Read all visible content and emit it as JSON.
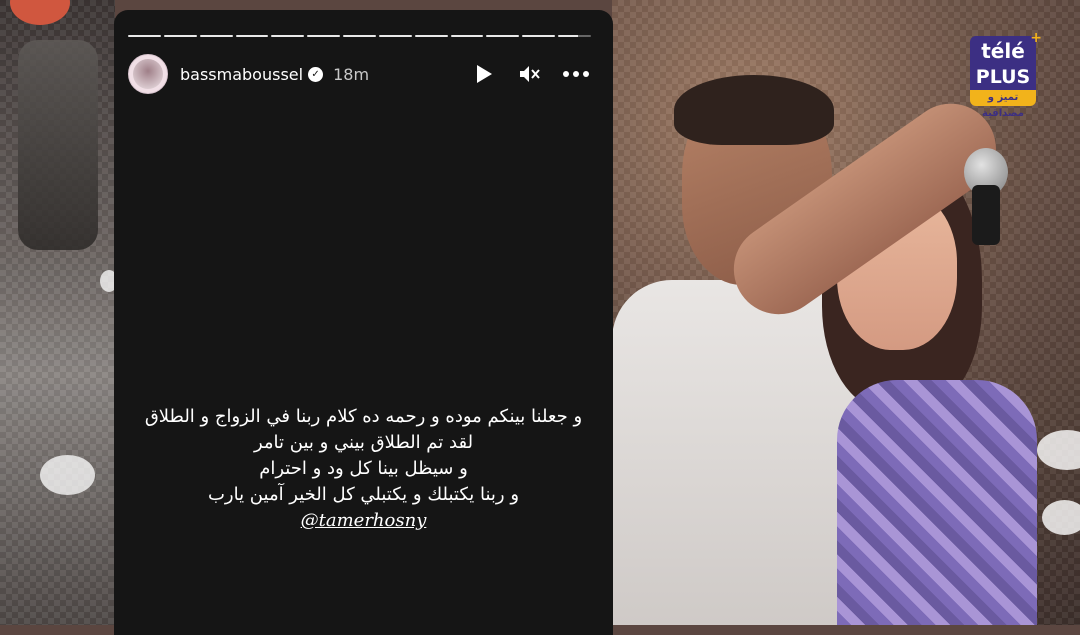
{
  "story": {
    "username": "bassmaboussel",
    "time": "18m",
    "segments": 13,
    "caption_lines": [
      "و جعلنا بينكم موده و رحمه ده كلام ربنا في الزواج و الطلاق",
      "لقد تم الطلاق بيني و بين تامر",
      "و سيظل بينا كل ود و احترام",
      "و ربنا يكتبلك و يكتبلي كل الخير آمين يارب"
    ],
    "mention": "@tamerhosny",
    "icons": {
      "avatar": "profile-avatar",
      "verified": "verified-badge-icon",
      "play": "play-icon",
      "mute": "mute-icon",
      "more": "more-options-icon"
    }
  },
  "brand": {
    "line1": "télé",
    "line2": "PLUS",
    "tagline": "تميز و مصداقية",
    "plus_mark": "+"
  },
  "colors": {
    "story_bg": "#151515",
    "brand_purple": "#3c2f83",
    "brand_yellow": "#f2b31b"
  }
}
